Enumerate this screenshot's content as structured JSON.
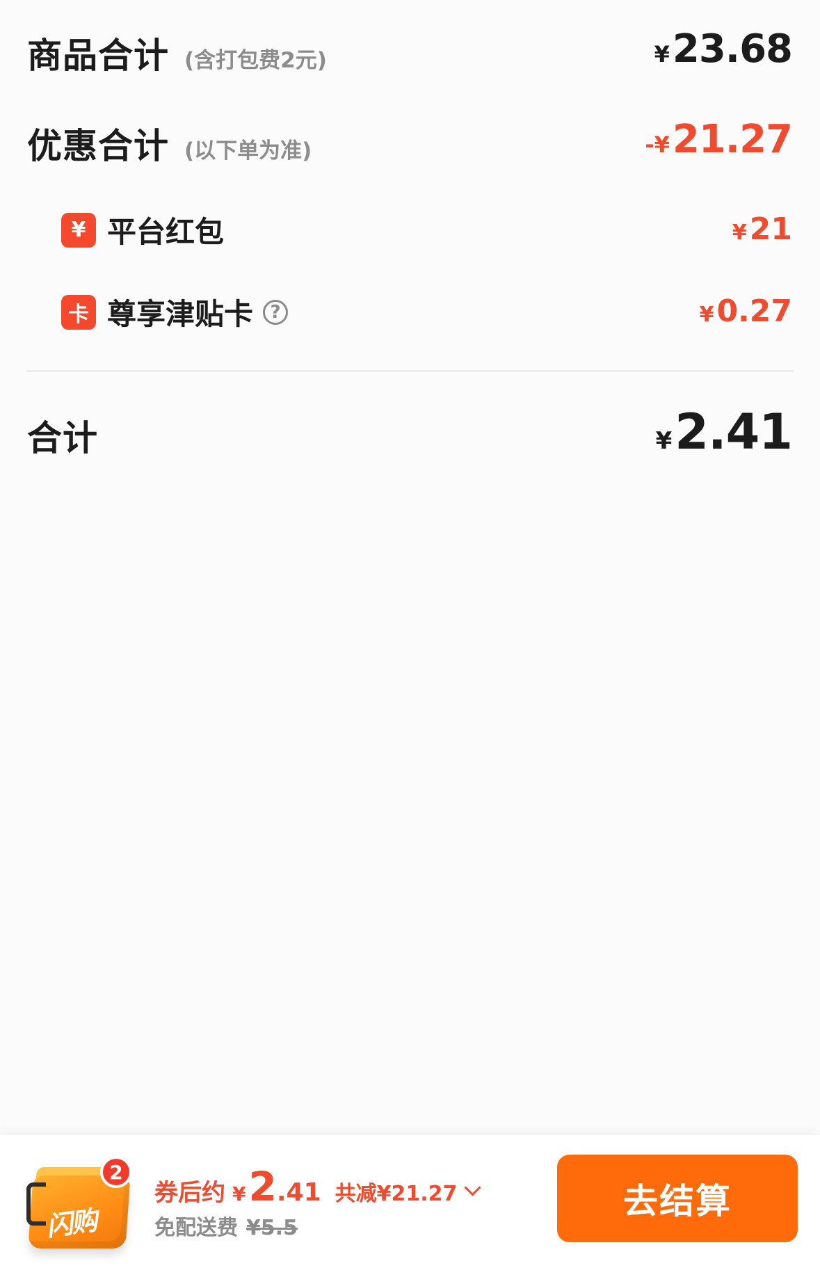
{
  "summary": {
    "goods_total": {
      "label": "商品合计",
      "hint": "(含打包费2元)",
      "currency": "¥",
      "amount": "23.68"
    },
    "discount_total": {
      "label": "优惠合计",
      "hint": "(以下单为准)",
      "currency": "-¥",
      "amount": "21.27"
    },
    "discounts": [
      {
        "badge": "¥",
        "icon": "yuan-badge-icon",
        "label": "平台红包",
        "currency": "¥",
        "amount": "21"
      },
      {
        "badge": "卡",
        "icon": "card-badge-icon",
        "label": "尊享津贴卡",
        "help_icon": "help-circle-icon",
        "help_symbol": "?",
        "currency": "¥",
        "amount": "0.27"
      }
    ],
    "total": {
      "label": "合计",
      "currency": "¥",
      "amount": "2.41"
    }
  },
  "bottom_bar": {
    "cart": {
      "icon": "flash-buy-bag-icon",
      "text": "闪购",
      "count": "2"
    },
    "after_coupon_label": "券后约",
    "estimate_currency": "¥",
    "estimate_int": "2",
    "estimate_dec": ".41",
    "saved_text": "共减¥21.27",
    "expand_icon": "chevron-down-icon",
    "delivery_label": "免配送费",
    "delivery_original": "¥5.5",
    "checkout_label": "去结算"
  },
  "colors": {
    "accent_red": "#f04a2f",
    "button_orange": "#ff6a0a",
    "text_dark": "#1c1c1c",
    "text_gray": "#8c8c8c",
    "background": "#fbfbfb"
  }
}
